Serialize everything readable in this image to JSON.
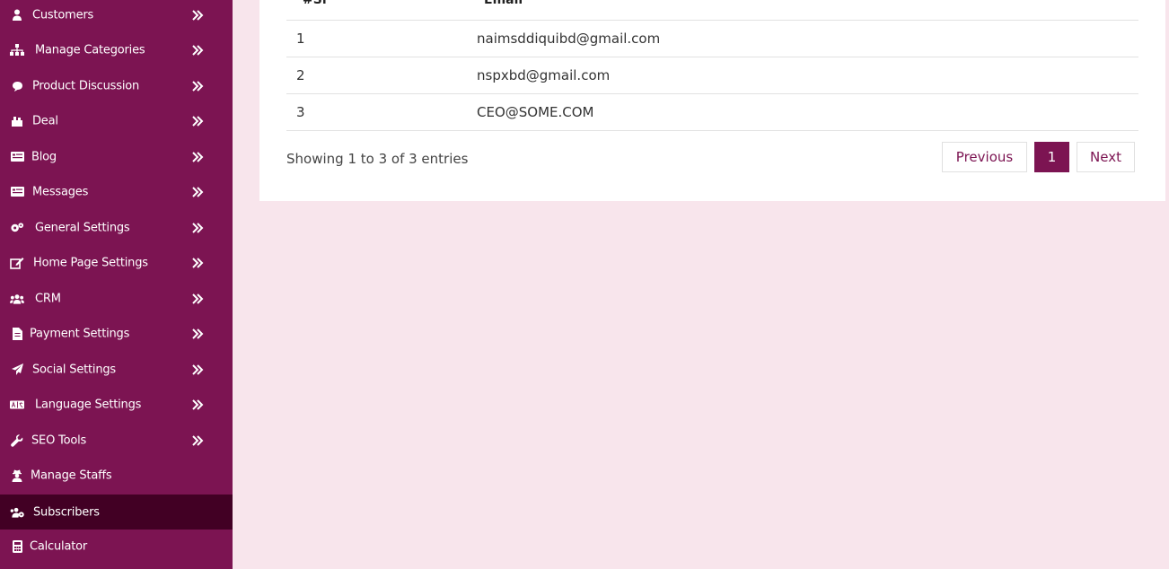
{
  "sidebar": {
    "items": [
      {
        "label": "Customers",
        "icon": "user-icon",
        "has_submenu": true
      },
      {
        "label": "Manage Categories",
        "icon": "sitemap-icon",
        "has_submenu": true
      },
      {
        "label": "Product Discussion",
        "icon": "comment-icon",
        "has_submenu": true
      },
      {
        "label": "Deal",
        "icon": "deal-icon",
        "has_submenu": true
      },
      {
        "label": "Blog",
        "icon": "blog-icon",
        "has_submenu": true
      },
      {
        "label": "Messages",
        "icon": "messages-icon",
        "has_submenu": true
      },
      {
        "label": "General Settings",
        "icon": "cogs-icon",
        "has_submenu": true
      },
      {
        "label": "Home Page Settings",
        "icon": "edit-icon",
        "has_submenu": true
      },
      {
        "label": "CRM",
        "icon": "users-icon",
        "has_submenu": true
      },
      {
        "label": "Payment Settings",
        "icon": "file-invoice-icon",
        "has_submenu": true
      },
      {
        "label": "Social Settings",
        "icon": "paper-plane-icon",
        "has_submenu": true
      },
      {
        "label": "Language Settings",
        "icon": "language-icon",
        "has_submenu": true
      },
      {
        "label": "SEO Tools",
        "icon": "wrench-icon",
        "has_submenu": true
      },
      {
        "label": "Manage Staffs",
        "icon": "user-secret-icon",
        "has_submenu": false
      },
      {
        "label": "Subscribers",
        "icon": "users-cog-icon",
        "has_submenu": false,
        "active": true
      },
      {
        "label": "Calculator",
        "icon": "calculator-icon",
        "has_submenu": false
      }
    ]
  },
  "table": {
    "headers": {
      "sl": "#Sl",
      "email": "Email"
    },
    "rows": [
      {
        "sl": "1",
        "email": "naimsddiquibd@gmail.com"
      },
      {
        "sl": "2",
        "email": "nspxbd@gmail.com"
      },
      {
        "sl": "3",
        "email": "CEO@SOME.COM"
      }
    ]
  },
  "pagination": {
    "info": "Showing 1 to 3 of 3 entries",
    "previous": "Previous",
    "current_page": "1",
    "next": "Next"
  },
  "colors": {
    "sidebar_bg": "#7c1452",
    "sidebar_active": "#420024",
    "page_bg": "#f8e5ec",
    "accent": "#7c1452"
  }
}
